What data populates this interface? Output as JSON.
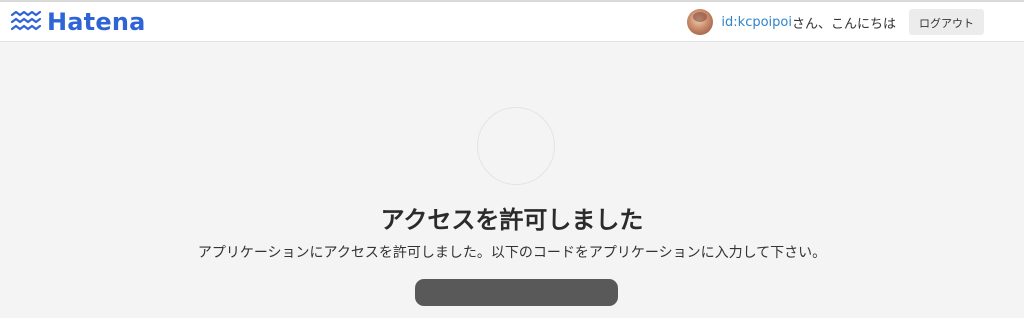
{
  "header": {
    "logo_text": "Hatena",
    "username": "id:kcpoipoi",
    "greeting": "さん、こんにちは",
    "logout_label": "ログアウト"
  },
  "main": {
    "title": "アクセスを許可しました",
    "description": "アプリケーションにアクセスを許可しました。以下のコードをアプリケーションに入力して下さい。",
    "code": ""
  },
  "colors": {
    "brand": "#2f64d6",
    "link": "#2f84c8",
    "page_background": "#f4f4f4",
    "code_box": "#595959"
  },
  "icons": {
    "logo": "hatena-logo-icon",
    "avatar": "user-avatar",
    "app_icon": "app-icon-placeholder"
  }
}
